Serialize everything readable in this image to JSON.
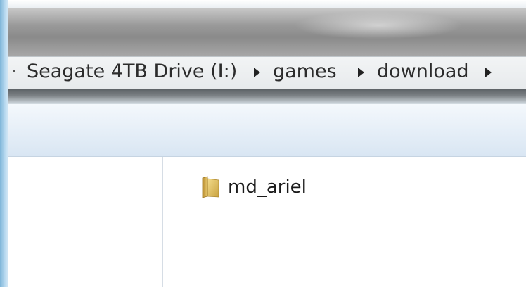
{
  "address_bar": {
    "breadcrumbs": [
      "Seagate 4TB Drive (I:)",
      "games",
      "download"
    ]
  },
  "file_list": {
    "items": [
      {
        "name": "md_ariel",
        "type": "folder",
        "icon": "folder-icon"
      }
    ]
  },
  "colors": {
    "frame": "#7fb6d9",
    "titlebar": "#9a9a9a",
    "address_bar": "#eceff1",
    "toolbar": "#e5eef7",
    "folder": "#e6c86a"
  }
}
